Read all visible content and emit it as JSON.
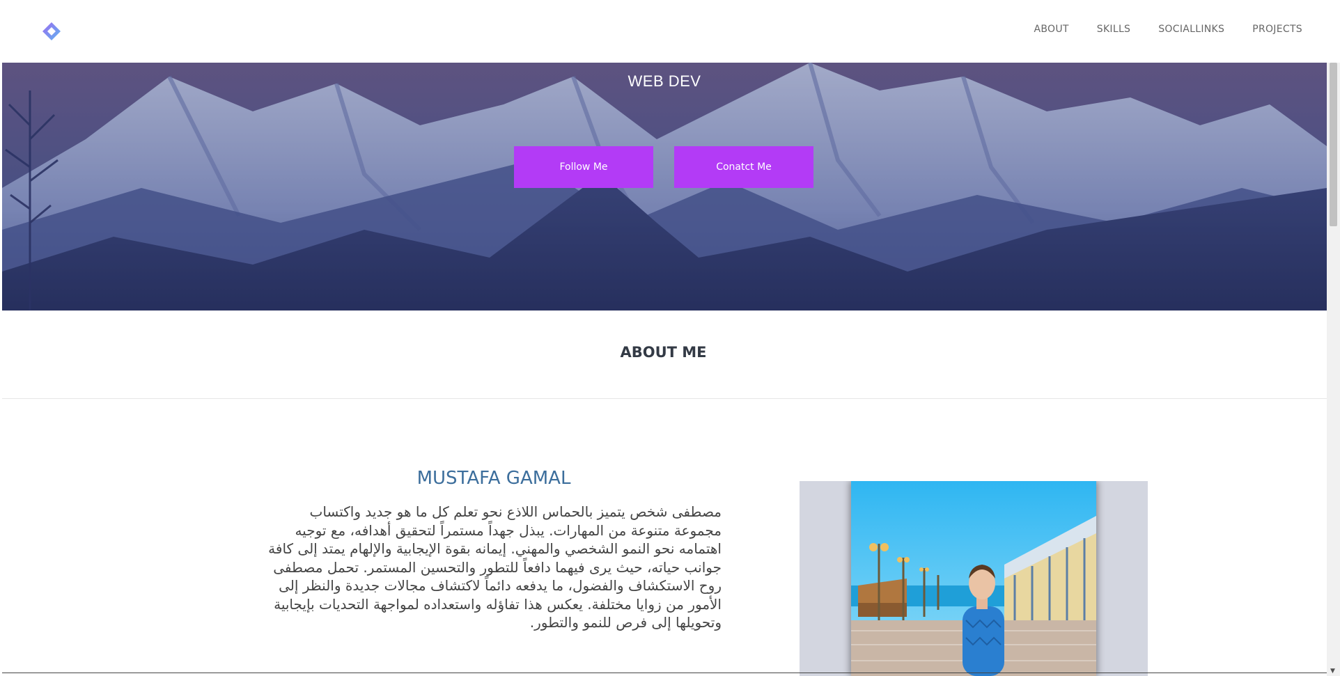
{
  "nav": {
    "logo_icon": "diamond-logo",
    "links": [
      {
        "label": "ABOUT"
      },
      {
        "label": "SKILLS"
      },
      {
        "label": "SOCIALLINKS"
      },
      {
        "label": "PROJECTS"
      }
    ]
  },
  "hero": {
    "title": "WEB DEV",
    "buttons": [
      {
        "label": "Follow Me"
      },
      {
        "label": "Conatct Me"
      }
    ]
  },
  "about": {
    "heading": "ABOUT ME",
    "name": "MUSTAFA GAMAL",
    "bio": "مصطفى شخص يتميز بالحماس اللاذع نحو تعلم كل ما هو جديد واكتساب مجموعة متنوعة من المهارات. يبذل جهداً مستمراً لتحقيق أهدافه، مع توجيه اهتمامه نحو النمو الشخصي والمهني. إيمانه بقوة الإيجابية والإلهام يمتد إلى كافة جوانب حياته، حيث يرى فيهما دافعاً للتطور والتحسين المستمر. تحمل مصطفى روح الاستكشاف والفضول، ما يدفعه دائماً لاكتشاف مجالات جديدة والنظر إلى الأمور من زوايا مختلفة. يعكس هذا تفاؤله واستعداده لمواجهة التحديات بإيجابية وتحويلها إلى فرص للنمو والتطور."
  },
  "colors": {
    "accent": "#b33bf6",
    "name_color": "#3c6e9c",
    "hero_overlay": "#2e3a6e"
  }
}
